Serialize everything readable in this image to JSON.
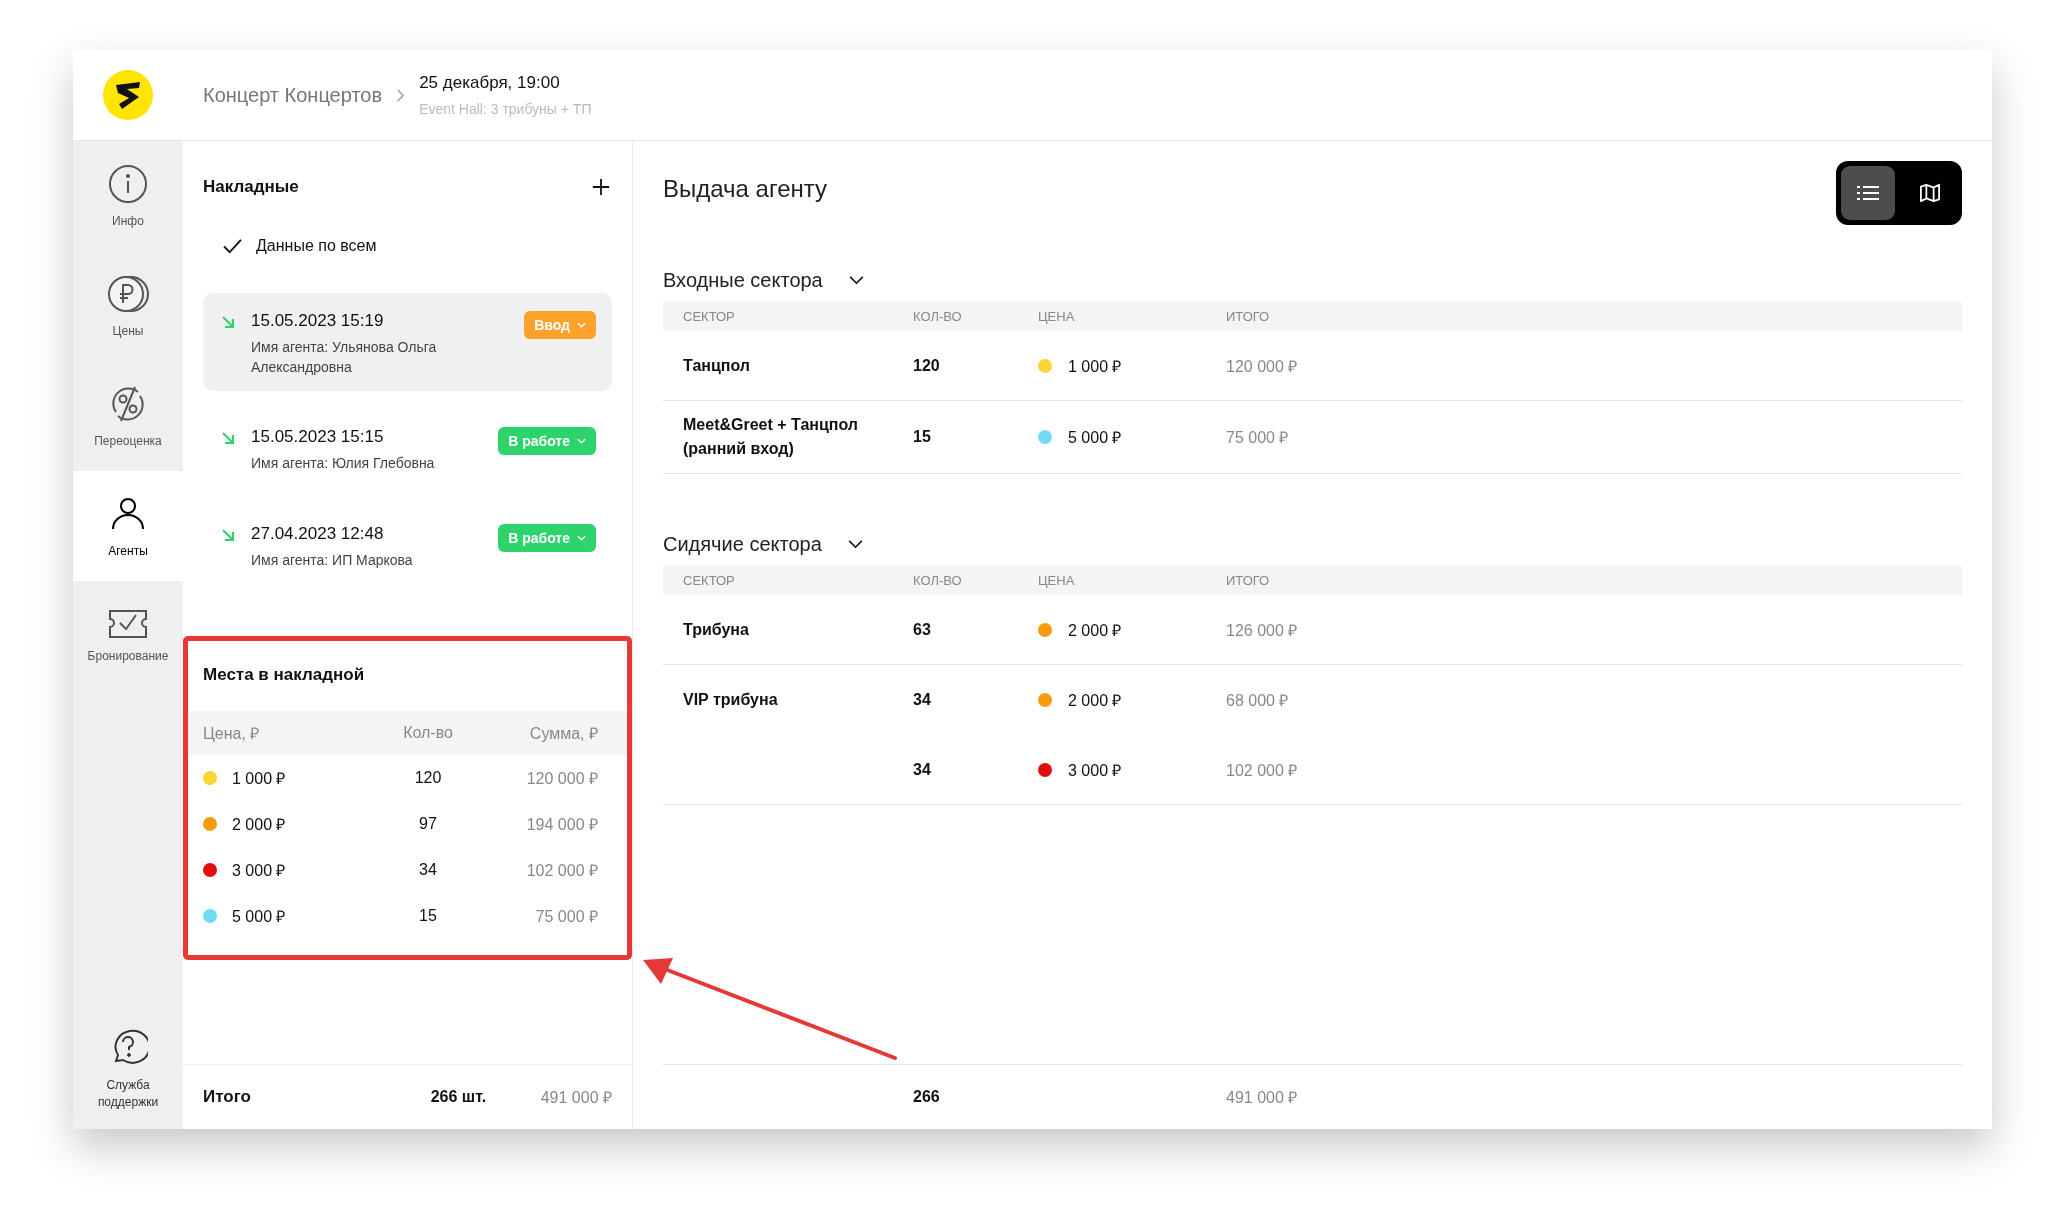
{
  "header": {
    "event_title": "Концерт Концертов",
    "date": "25 декабря, 19:00",
    "venue": "Event Hall: 3 трибуны + ТП"
  },
  "sidebar": {
    "items": [
      {
        "label": "Инфо",
        "selected": false
      },
      {
        "label": "Цены",
        "selected": false
      },
      {
        "label": "Переоценка",
        "selected": false
      },
      {
        "label": "Агенты",
        "selected": true
      },
      {
        "label": "Бронирование",
        "selected": false
      }
    ],
    "support": {
      "label": "Служба поддержки"
    }
  },
  "invoices": {
    "title": "Накладные",
    "all_data": {
      "label": "Данные по всем",
      "checked": true
    },
    "items": [
      {
        "datetime": "15.05.2023 15:19",
        "agent": "Имя агента: Ульянова Ольга Александровна",
        "status": "Ввод",
        "color": "#fca12a",
        "selected": true
      },
      {
        "datetime": "15.05.2023 15:15",
        "agent": "Имя агента: Юлия Глебовна",
        "status": "В работе",
        "color": "#2dd36b",
        "selected": false
      },
      {
        "datetime": "27.04.2023 12:48",
        "agent": "Имя агента: ИП Маркова",
        "status": "В работе",
        "color": "#2dd36b",
        "selected": false
      }
    ]
  },
  "seats": {
    "title": "Места в накладной",
    "columns": [
      "Цена, ₽",
      "Кол-во",
      "Сумма, ₽"
    ],
    "rows": [
      {
        "color": "#fcd535",
        "price": "1 000 ₽",
        "qty": "120",
        "sum": "120 000 ₽"
      },
      {
        "color": "#fb9a0c",
        "price": "2 000 ₽",
        "qty": "97",
        "sum": "194 000 ₽"
      },
      {
        "color": "#e00f0f",
        "price": "3 000 ₽",
        "qty": "34",
        "sum": "102 000 ₽"
      },
      {
        "color": "#6fdcf2",
        "price": "5 000 ₽",
        "qty": "15",
        "sum": "75 000 ₽"
      }
    ]
  },
  "invoice_total": {
    "label": "Итого",
    "qty": "266 шт.",
    "sum": "491 000 ₽"
  },
  "main": {
    "title": "Выдача агенту",
    "view_toggle": [
      {
        "selected": true
      },
      {
        "selected": false
      }
    ],
    "sections": [
      {
        "title": "Входные сектора",
        "expanded": true,
        "columns": [
          "СЕКТОР",
          "КОЛ-ВО",
          "ЦЕНА",
          "ИТОГО"
        ],
        "rows": [
          {
            "sector": "Танцпол",
            "qty": "120",
            "color": "#fcd535",
            "price": "1 000 ₽",
            "total": "120 000 ₽"
          },
          {
            "sector": "Meet&Greet + Танцпол (ранний вход)",
            "qty": "15",
            "color": "#6fdcf2",
            "price": "5 000 ₽",
            "total": "75 000 ₽"
          }
        ]
      },
      {
        "title": "Сидячие сектора",
        "expanded": true,
        "columns": [
          "СЕКТОР",
          "КОЛ-ВО",
          "ЦЕНА",
          "ИТОГО"
        ],
        "rows": [
          {
            "sector": "Трибуна",
            "qty": "63",
            "color": "#fb9a0c",
            "price": "2 000 ₽",
            "total": "126 000 ₽"
          },
          {
            "sector": "VIP трибуна",
            "qty": "34",
            "color": "#fb9a0c",
            "price": "2 000 ₽",
            "total": "68 000 ₽"
          },
          {
            "qty": "34",
            "color": "#e00f0f",
            "price": "3 000 ₽",
            "total": "102 000 ₽"
          }
        ]
      }
    ],
    "total": {
      "qty": "266",
      "sum": "491 000 ₽"
    }
  }
}
